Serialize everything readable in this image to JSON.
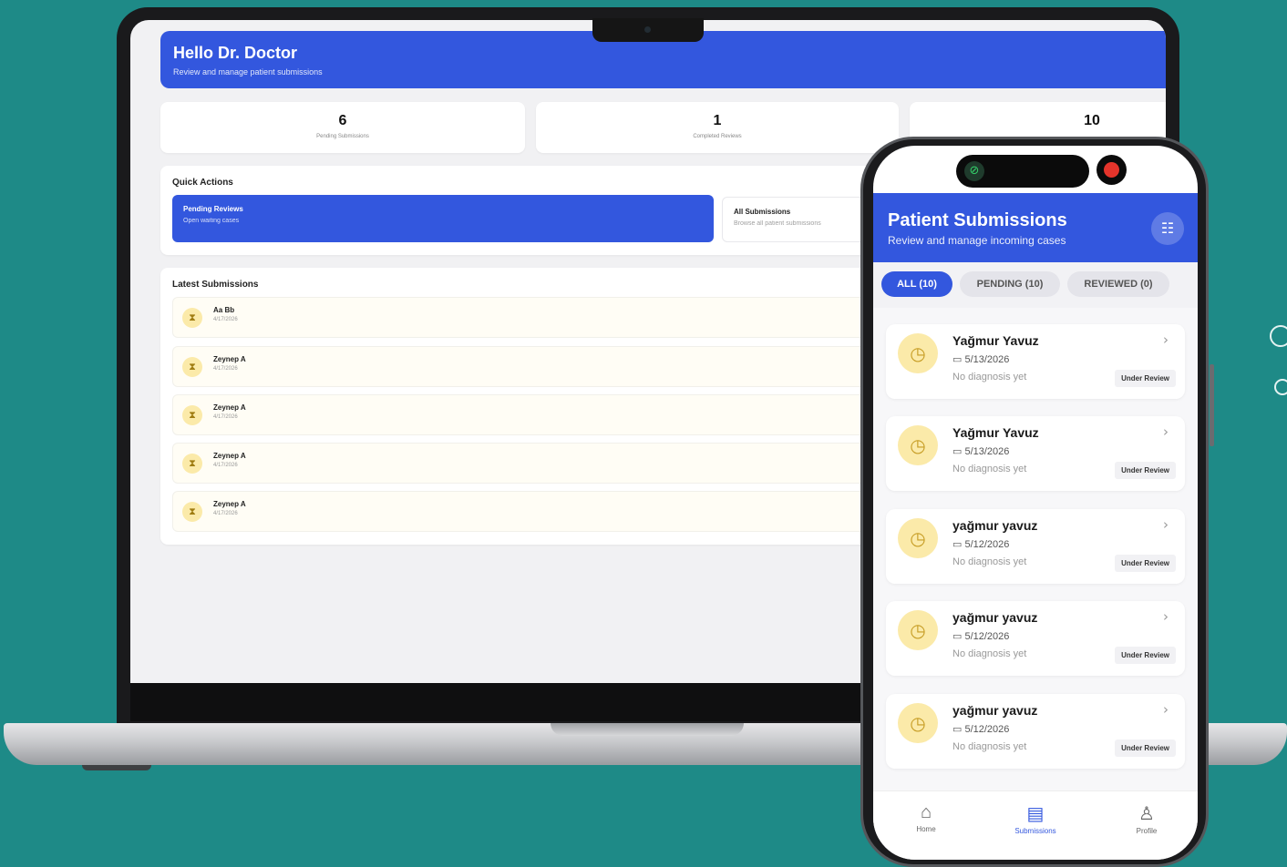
{
  "desktop": {
    "greeting": "Hello Dr. Doctor",
    "greeting_sub": "Review and manage patient submissions",
    "stats": [
      {
        "value": "6",
        "label": "Pending Submissions"
      },
      {
        "value": "1",
        "label": "Completed Reviews"
      },
      {
        "value": "10",
        "label": ""
      }
    ],
    "quick_actions_title": "Quick Actions",
    "quick_actions": [
      {
        "title": "Pending Reviews",
        "subtitle": "Open waiting cases"
      },
      {
        "title": "All Submissions",
        "subtitle": "Browse all patient submissions"
      }
    ],
    "latest_title": "Latest Submissions",
    "latest": [
      {
        "name": "Aa Bb",
        "date": "4/17/2026"
      },
      {
        "name": "Zeynep A",
        "date": "4/17/2026"
      },
      {
        "name": "Zeynep A",
        "date": "4/17/2026"
      },
      {
        "name": "Zeynep A",
        "date": "4/17/2026"
      },
      {
        "name": "Zeynep A",
        "date": "4/17/2026"
      }
    ]
  },
  "mobile": {
    "title": "Patient Submissions",
    "subtitle": "Review and manage incoming cases",
    "tabs": [
      {
        "label": "ALL (10)",
        "active": true
      },
      {
        "label": "PENDING (10)",
        "active": false
      },
      {
        "label": "REVIEWED (0)",
        "active": false
      }
    ],
    "cards": [
      {
        "name": "Yağmur Yavuz",
        "date": "5/13/2026",
        "diagnosis": "No diagnosis yet",
        "status": "Under Review"
      },
      {
        "name": "Yağmur Yavuz",
        "date": "5/13/2026",
        "diagnosis": "No diagnosis yet",
        "status": "Under Review"
      },
      {
        "name": "yağmur yavuz",
        "date": "5/12/2026",
        "diagnosis": "No diagnosis yet",
        "status": "Under Review"
      },
      {
        "name": "yağmur yavuz",
        "date": "5/12/2026",
        "diagnosis": "No diagnosis yet",
        "status": "Under Review"
      },
      {
        "name": "yağmur yavuz",
        "date": "5/12/2026",
        "diagnosis": "No diagnosis yet",
        "status": "Under Review"
      }
    ],
    "nav": [
      {
        "label": "Home",
        "icon": "home-icon",
        "active": false
      },
      {
        "label": "Submissions",
        "icon": "document-icon",
        "active": true
      },
      {
        "label": "Profile",
        "icon": "person-icon",
        "active": false
      }
    ]
  },
  "colors": {
    "background": "#1e8a87",
    "primary": "#3357de",
    "pending_icon_bg": "#fbeaa9"
  }
}
